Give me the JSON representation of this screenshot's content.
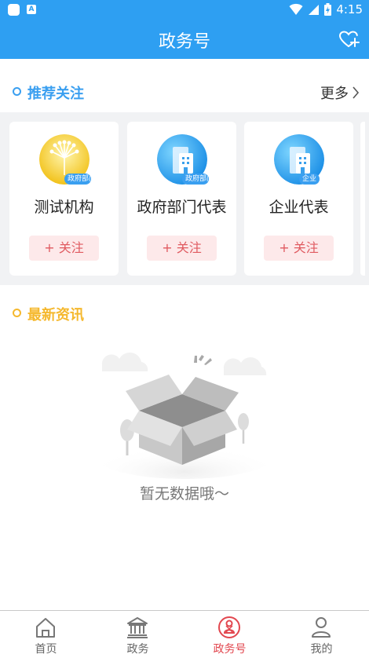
{
  "status_bar": {
    "time": "4:15",
    "sim_badge": "A"
  },
  "app_bar": {
    "title": "政务号"
  },
  "recommend": {
    "title": "推荐关注",
    "more_label": "更多",
    "accent": "#3a9ff0",
    "cards": [
      {
        "name": "测试机构",
        "tag": "政府部门",
        "follow": "+ 关注",
        "logo": "peacock-logo"
      },
      {
        "name": "政府部门代表",
        "tag": "政府部门",
        "follow": "+ 关注",
        "logo": "building-logo"
      },
      {
        "name": "企业代表",
        "tag": "企业",
        "follow": "+ 关注",
        "logo": "building-logo"
      }
    ]
  },
  "news": {
    "title": "最新资讯",
    "accent": "#f5b82e",
    "empty_text": "暂无数据哦～"
  },
  "tabs": [
    {
      "label": "首页",
      "icon": "home-icon"
    },
    {
      "label": "政务",
      "icon": "government-icon"
    },
    {
      "label": "政务号",
      "icon": "gov-account-icon",
      "active": true
    },
    {
      "label": "我的",
      "icon": "user-icon"
    }
  ]
}
